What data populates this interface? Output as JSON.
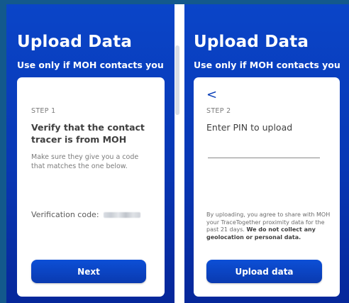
{
  "screens": [
    {
      "title": "Upload Data",
      "subtitle": "Use only if MOH contacts you",
      "step_label": "STEP 1",
      "heading": "Verify that the contact tracer is from MOH",
      "description": "Make sure they give you a code that matches the one below.",
      "verification_label": "Verification code:",
      "button_label": "Next"
    },
    {
      "title": "Upload Data",
      "subtitle": "Use only if MOH contacts you",
      "back_icon": "<",
      "step_label": "STEP 2",
      "heading": "Enter PIN to upload",
      "pin_value": "",
      "consent_text": "By uploading, you agree to share with MOH your TraceTogether proximity data for the past 21 days.",
      "consent_bold": "We do not collect any geolocation or personal data.",
      "button_label": "Upload data"
    }
  ],
  "colors": {
    "background": "#13598c",
    "panel": "#0a45c8",
    "primary_button": "#0a3fb8",
    "card": "#ffffff"
  }
}
